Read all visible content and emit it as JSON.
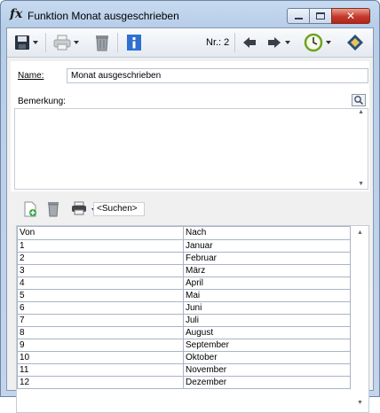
{
  "window": {
    "icon": "fx-icon",
    "title": "Funktion Monat ausgeschrieben",
    "buttons": [
      "minimize",
      "maximize",
      "close"
    ]
  },
  "toolbar": {
    "record_label": "Nr.: 2",
    "icons": [
      "save-icon",
      "print-icon",
      "delete-icon",
      "info-icon",
      "prev-icon",
      "next-icon",
      "history-icon",
      "book-icon"
    ]
  },
  "form": {
    "name_label": "Name:",
    "name_value": "Monat ausgeschrieben",
    "remark_label": "Bemerkung:",
    "remark_value": ""
  },
  "grid_toolbar": {
    "search_placeholder": "<Suchen>"
  },
  "grid": {
    "columns": [
      "Von",
      "Nach"
    ],
    "rows": [
      [
        "1",
        "Januar"
      ],
      [
        "2",
        "Februar"
      ],
      [
        "3",
        "März"
      ],
      [
        "4",
        "April"
      ],
      [
        "5",
        "Mai"
      ],
      [
        "6",
        "Juni"
      ],
      [
        "7",
        "Juli"
      ],
      [
        "8",
        "August"
      ],
      [
        "9",
        "September"
      ],
      [
        "10",
        "Oktober"
      ],
      [
        "11",
        "November"
      ],
      [
        "12",
        "Dezember"
      ]
    ]
  }
}
